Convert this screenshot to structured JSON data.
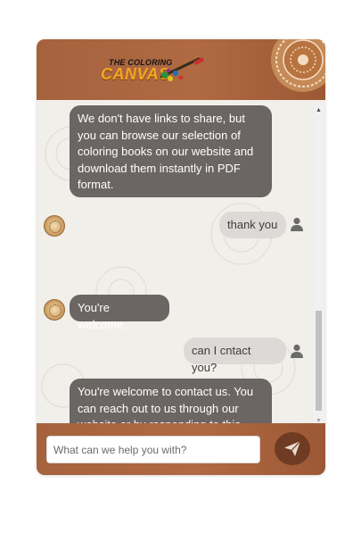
{
  "header": {
    "logo_line1": "THE COLORING",
    "logo_line2": "CANVAS"
  },
  "messages": [
    {
      "sender": "bot",
      "text": "We don't have links to share, but\nyou can browse our selection of\ncoloring books on our website and\ndownload them instantly in PDF\nformat."
    },
    {
      "sender": "user",
      "text": "thank you"
    },
    {
      "sender": "bot",
      "text": "You're welcome."
    },
    {
      "sender": "user",
      "text": "can I cntact you?"
    },
    {
      "sender": "bot",
      "text": "You're welcome to contact us. You\ncan reach out to us through our\nwebsite or by responding to this\nchat."
    }
  ],
  "composer": {
    "placeholder": "What can we help you with?",
    "value": ""
  },
  "colors": {
    "header_brown": "#a5623d",
    "bot_bubble": "#6b6564",
    "user_bubble": "#dcdad7",
    "send_button": "#6f3b22",
    "logo_orange": "#f3a81f"
  },
  "icons": {
    "send": "paper-plane-icon",
    "user_avatar": "user-silhouette-icon",
    "bot_avatar": "mandala-avatar-icon"
  }
}
